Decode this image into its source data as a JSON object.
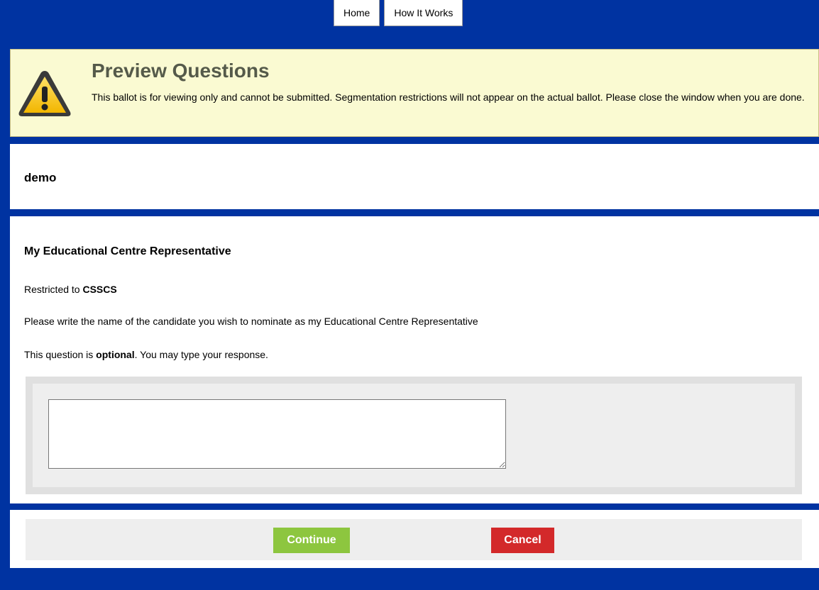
{
  "nav": {
    "tabs": [
      {
        "label": "Home"
      },
      {
        "label": "How It Works"
      }
    ]
  },
  "banner": {
    "icon": "warning-triangle-icon",
    "title": "Preview Questions",
    "text": "This ballot is for viewing only and cannot be submitted. Segmentation restrictions will not appear on the actual ballot. Please close the window when you are done."
  },
  "election": {
    "name": "demo"
  },
  "question": {
    "title": "My Educational Centre Representative",
    "restricted_prefix": "Restricted to ",
    "restricted_group": "CSSCS",
    "description": "Please write the name of the candidate you wish to nominate as my Educational Centre Representative",
    "optional_prefix": "This question is ",
    "optional_word": "optional",
    "optional_suffix": ". You may type your response.",
    "answer_value": ""
  },
  "actions": {
    "continue_label": "Continue",
    "cancel_label": "Cancel"
  },
  "colors": {
    "page_background": "#0033a1",
    "banner_background": "#fafad2",
    "continue_button": "#8dc63f",
    "cancel_button": "#d3292a"
  }
}
